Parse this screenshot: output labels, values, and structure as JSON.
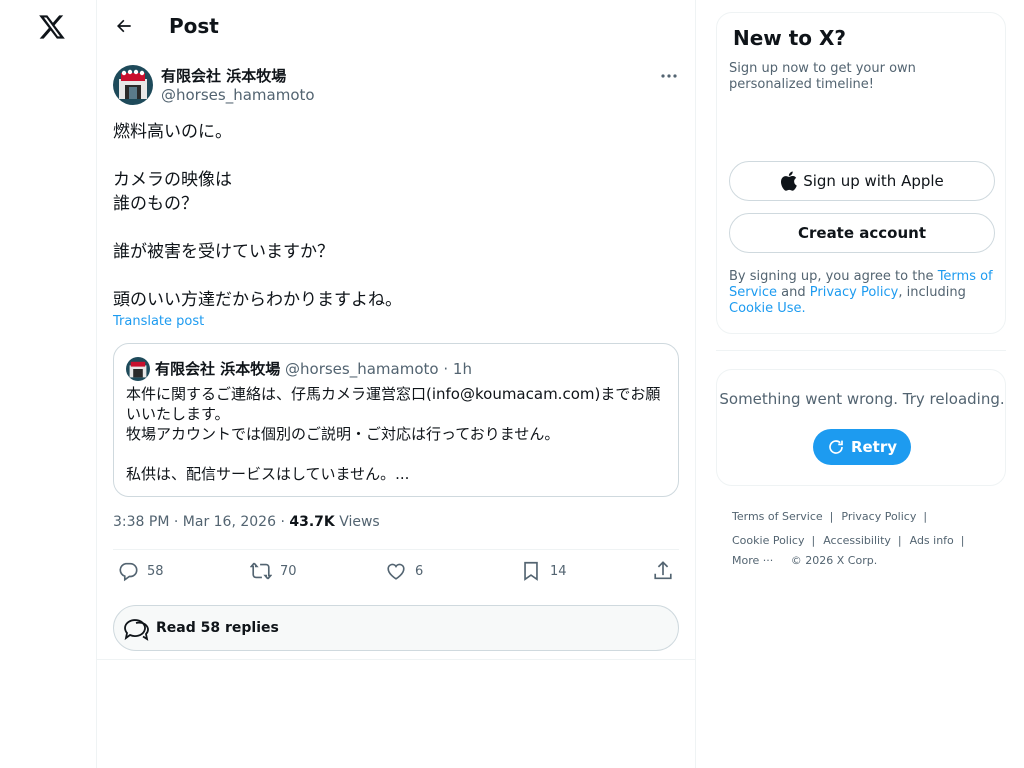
{
  "app": {
    "brand": "X",
    "accent_color": "#1d9bf0"
  },
  "header": {
    "title": "Post",
    "back_icon": "arrow-left-icon"
  },
  "post": {
    "author_name": "有限会社 浜本牧場",
    "author_handle": "@horses_hamamoto",
    "text": "燃料高いのに。\n\nカメラの映像は\n誰のもの？\n\n誰が被害を受けていますか？\n\n頭のいい方達だからわかりますよね。",
    "translate_label": "Translate post",
    "time": "3:38 PM",
    "date": "Mar 16, 2026",
    "views_count": "43.7K",
    "views_label": "Views",
    "stats": {
      "replies": "58",
      "reposts": "70",
      "likes": "6",
      "bookmarks": "14"
    }
  },
  "quote": {
    "author_name": "有限会社 浜本牧場",
    "author_handle": "@horses_hamamoto",
    "separator": "·",
    "time": "1h",
    "text": "本件に関するご連絡は、仔馬カメラ運営窓口(info@koumacam.com)までお願いいたします。\n牧場アカウントでは個別のご説明・ご対応は行っておりません。\n\n私供は、配信サービスはしていません。..."
  },
  "read_replies_label": "Read 58 replies",
  "signup": {
    "title": "New to X?",
    "subtitle": "Sign up now to get your own personalized timeline!",
    "apple_label": "Sign up with Apple",
    "create_label": "Create account",
    "terms_prefix": "By signing up, you agree to the ",
    "terms_link": "Terms of Service",
    "terms_and": " and ",
    "privacy_link": "Privacy Policy",
    "terms_including": ", including ",
    "cookie_link": "Cookie Use.",
    "terms_suffix": ""
  },
  "error": {
    "message": "Something went wrong. Try reloading.",
    "retry_label": "Retry"
  },
  "footer": {
    "terms": "Terms of Service",
    "privacy": "Privacy Policy",
    "cookie": "Cookie Policy",
    "accessibility": "Accessibility",
    "ads_info": "Ads info",
    "more": "More ···",
    "copyright": "© 2026 X Corp.",
    "separator": "|"
  }
}
